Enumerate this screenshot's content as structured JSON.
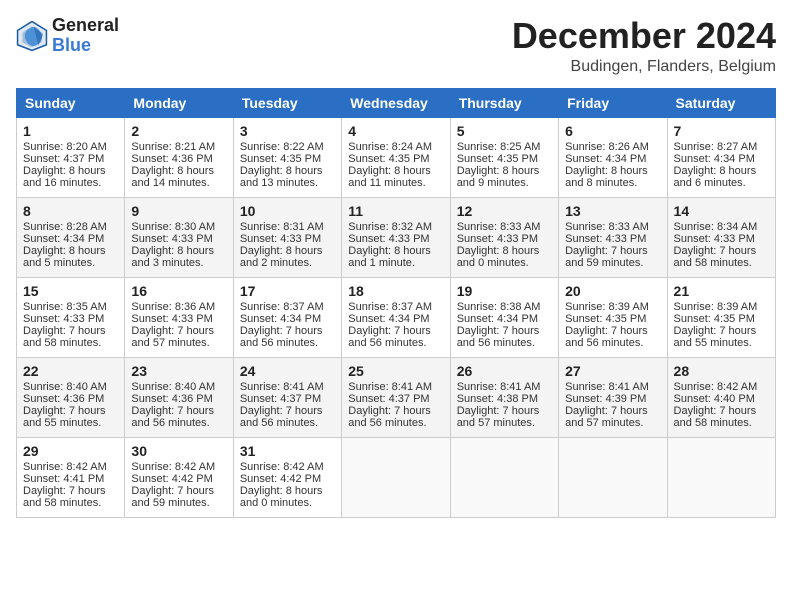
{
  "header": {
    "logo_line1": "General",
    "logo_line2": "Blue",
    "month_title": "December 2024",
    "location": "Budingen, Flanders, Belgium"
  },
  "days_of_week": [
    "Sunday",
    "Monday",
    "Tuesday",
    "Wednesday",
    "Thursday",
    "Friday",
    "Saturday"
  ],
  "weeks": [
    [
      {
        "day": "1",
        "lines": [
          "Sunrise: 8:20 AM",
          "Sunset: 4:37 PM",
          "Daylight: 8 hours",
          "and 16 minutes."
        ]
      },
      {
        "day": "2",
        "lines": [
          "Sunrise: 8:21 AM",
          "Sunset: 4:36 PM",
          "Daylight: 8 hours",
          "and 14 minutes."
        ]
      },
      {
        "day": "3",
        "lines": [
          "Sunrise: 8:22 AM",
          "Sunset: 4:35 PM",
          "Daylight: 8 hours",
          "and 13 minutes."
        ]
      },
      {
        "day": "4",
        "lines": [
          "Sunrise: 8:24 AM",
          "Sunset: 4:35 PM",
          "Daylight: 8 hours",
          "and 11 minutes."
        ]
      },
      {
        "day": "5",
        "lines": [
          "Sunrise: 8:25 AM",
          "Sunset: 4:35 PM",
          "Daylight: 8 hours",
          "and 9 minutes."
        ]
      },
      {
        "day": "6",
        "lines": [
          "Sunrise: 8:26 AM",
          "Sunset: 4:34 PM",
          "Daylight: 8 hours",
          "and 8 minutes."
        ]
      },
      {
        "day": "7",
        "lines": [
          "Sunrise: 8:27 AM",
          "Sunset: 4:34 PM",
          "Daylight: 8 hours",
          "and 6 minutes."
        ]
      }
    ],
    [
      {
        "day": "8",
        "lines": [
          "Sunrise: 8:28 AM",
          "Sunset: 4:34 PM",
          "Daylight: 8 hours",
          "and 5 minutes."
        ]
      },
      {
        "day": "9",
        "lines": [
          "Sunrise: 8:30 AM",
          "Sunset: 4:33 PM",
          "Daylight: 8 hours",
          "and 3 minutes."
        ]
      },
      {
        "day": "10",
        "lines": [
          "Sunrise: 8:31 AM",
          "Sunset: 4:33 PM",
          "Daylight: 8 hours",
          "and 2 minutes."
        ]
      },
      {
        "day": "11",
        "lines": [
          "Sunrise: 8:32 AM",
          "Sunset: 4:33 PM",
          "Daylight: 8 hours",
          "and 1 minute."
        ]
      },
      {
        "day": "12",
        "lines": [
          "Sunrise: 8:33 AM",
          "Sunset: 4:33 PM",
          "Daylight: 8 hours",
          "and 0 minutes."
        ]
      },
      {
        "day": "13",
        "lines": [
          "Sunrise: 8:33 AM",
          "Sunset: 4:33 PM",
          "Daylight: 7 hours",
          "and 59 minutes."
        ]
      },
      {
        "day": "14",
        "lines": [
          "Sunrise: 8:34 AM",
          "Sunset: 4:33 PM",
          "Daylight: 7 hours",
          "and 58 minutes."
        ]
      }
    ],
    [
      {
        "day": "15",
        "lines": [
          "Sunrise: 8:35 AM",
          "Sunset: 4:33 PM",
          "Daylight: 7 hours",
          "and 58 minutes."
        ]
      },
      {
        "day": "16",
        "lines": [
          "Sunrise: 8:36 AM",
          "Sunset: 4:33 PM",
          "Daylight: 7 hours",
          "and 57 minutes."
        ]
      },
      {
        "day": "17",
        "lines": [
          "Sunrise: 8:37 AM",
          "Sunset: 4:34 PM",
          "Daylight: 7 hours",
          "and 56 minutes."
        ]
      },
      {
        "day": "18",
        "lines": [
          "Sunrise: 8:37 AM",
          "Sunset: 4:34 PM",
          "Daylight: 7 hours",
          "and 56 minutes."
        ]
      },
      {
        "day": "19",
        "lines": [
          "Sunrise: 8:38 AM",
          "Sunset: 4:34 PM",
          "Daylight: 7 hours",
          "and 56 minutes."
        ]
      },
      {
        "day": "20",
        "lines": [
          "Sunrise: 8:39 AM",
          "Sunset: 4:35 PM",
          "Daylight: 7 hours",
          "and 56 minutes."
        ]
      },
      {
        "day": "21",
        "lines": [
          "Sunrise: 8:39 AM",
          "Sunset: 4:35 PM",
          "Daylight: 7 hours",
          "and 55 minutes."
        ]
      }
    ],
    [
      {
        "day": "22",
        "lines": [
          "Sunrise: 8:40 AM",
          "Sunset: 4:36 PM",
          "Daylight: 7 hours",
          "and 55 minutes."
        ]
      },
      {
        "day": "23",
        "lines": [
          "Sunrise: 8:40 AM",
          "Sunset: 4:36 PM",
          "Daylight: 7 hours",
          "and 56 minutes."
        ]
      },
      {
        "day": "24",
        "lines": [
          "Sunrise: 8:41 AM",
          "Sunset: 4:37 PM",
          "Daylight: 7 hours",
          "and 56 minutes."
        ]
      },
      {
        "day": "25",
        "lines": [
          "Sunrise: 8:41 AM",
          "Sunset: 4:37 PM",
          "Daylight: 7 hours",
          "and 56 minutes."
        ]
      },
      {
        "day": "26",
        "lines": [
          "Sunrise: 8:41 AM",
          "Sunset: 4:38 PM",
          "Daylight: 7 hours",
          "and 57 minutes."
        ]
      },
      {
        "day": "27",
        "lines": [
          "Sunrise: 8:41 AM",
          "Sunset: 4:39 PM",
          "Daylight: 7 hours",
          "and 57 minutes."
        ]
      },
      {
        "day": "28",
        "lines": [
          "Sunrise: 8:42 AM",
          "Sunset: 4:40 PM",
          "Daylight: 7 hours",
          "and 58 minutes."
        ]
      }
    ],
    [
      {
        "day": "29",
        "lines": [
          "Sunrise: 8:42 AM",
          "Sunset: 4:41 PM",
          "Daylight: 7 hours",
          "and 58 minutes."
        ]
      },
      {
        "day": "30",
        "lines": [
          "Sunrise: 8:42 AM",
          "Sunset: 4:42 PM",
          "Daylight: 7 hours",
          "and 59 minutes."
        ]
      },
      {
        "day": "31",
        "lines": [
          "Sunrise: 8:42 AM",
          "Sunset: 4:42 PM",
          "Daylight: 8 hours",
          "and 0 minutes."
        ]
      },
      null,
      null,
      null,
      null
    ]
  ]
}
